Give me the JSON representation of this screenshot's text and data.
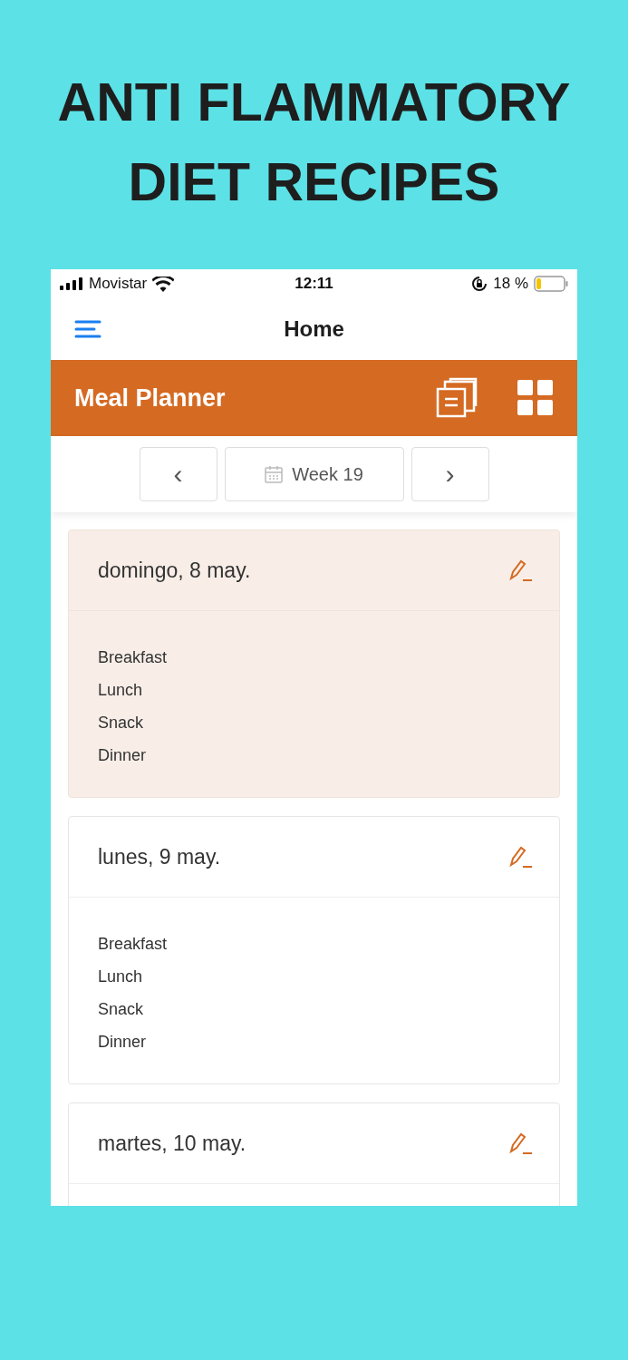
{
  "promo_title": [
    "ANTI FLAMMATORY",
    "DIET RECIPES"
  ],
  "status_bar": {
    "carrier": "Movistar",
    "time": "12:11",
    "battery_text": "18 %",
    "battery": {
      "level": 0.18
    }
  },
  "nav_bar": {
    "title": "Home"
  },
  "planner_bar": {
    "title": "Meal Planner"
  },
  "week_nav": {
    "prev": "‹",
    "week": "Week 19",
    "next": "›"
  },
  "days": [
    {
      "date": "domingo, 8 may.",
      "selected": true,
      "meals": [
        "Breakfast",
        "Lunch",
        "Snack",
        "Dinner"
      ]
    },
    {
      "date": "lunes, 9 may.",
      "selected": false,
      "meals": [
        "Breakfast",
        "Lunch",
        "Snack",
        "Dinner"
      ]
    },
    {
      "date": "martes, 10 may.",
      "selected": false
    }
  ]
}
